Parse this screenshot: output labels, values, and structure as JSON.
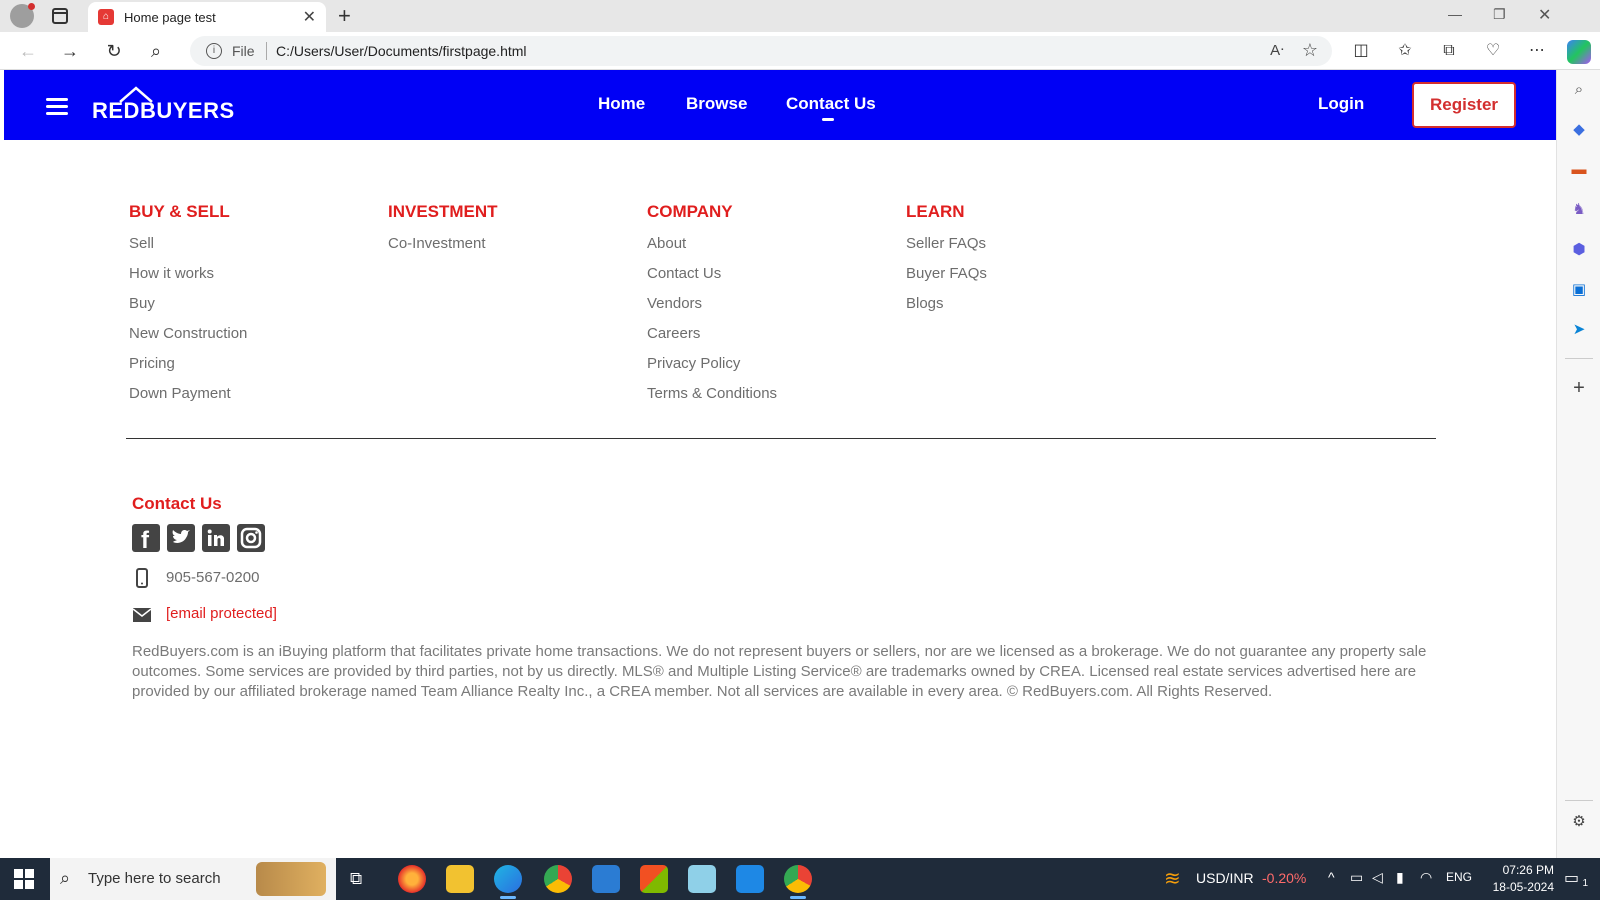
{
  "browser": {
    "tab_title": "Home page test",
    "url_scheme": "File",
    "url": "C:/Users/User/Documents/firstpage.html",
    "read_aloud": "A¹°"
  },
  "site": {
    "logo_text": "REDBUYERS",
    "nav": [
      "Home",
      "Browse",
      "Contact Us"
    ],
    "login_label": "Login",
    "register_label": "Register"
  },
  "footer": {
    "columns": [
      {
        "heading": "BUY & SELL",
        "links": [
          "Sell",
          "How it works",
          "Buy",
          "New Construction",
          "Pricing",
          "Down Payment"
        ]
      },
      {
        "heading": "INVESTMENT",
        "links": [
          "Co-Investment"
        ]
      },
      {
        "heading": "COMPANY",
        "links": [
          "About",
          "Contact Us",
          "Vendors",
          "Careers",
          "Privacy Policy",
          "Terms & Conditions"
        ]
      },
      {
        "heading": "LEARN",
        "links": [
          "Seller FAQs",
          "Buyer FAQs",
          "Blogs"
        ]
      }
    ],
    "contact_heading": "Contact Us",
    "social_icons": [
      "facebook-icon",
      "twitter-icon",
      "linkedin-icon",
      "instagram-icon"
    ],
    "phone": "905-567-0200",
    "email": "[email protected]",
    "disclaimer": "RedBuyers.com is an iBuying platform that facilitates private home transactions. We do not represent buyers or sellers, nor are we licensed as a brokerage. We do not guarantee any property sale outcomes. Some services are provided by third parties, not by us directly. MLS® and Multiple Listing Service® are trademarks owned by CREA. Licensed real estate services advertised here are provided by our affiliated brokerage named Team Alliance Realty Inc., a CREA member. Not all services are available in every area. © RedBuyers.com. All Rights Reserved."
  },
  "taskbar": {
    "search_placeholder": "Type here to search",
    "ticker": "USD/INR",
    "ticker_change": "-0.20%",
    "language": "ENG",
    "time": "07:26 PM",
    "date": "18-05-2024",
    "notification_count": "1"
  },
  "colors": {
    "header_blue": "#0000f5",
    "accent_red": "#e01e1e",
    "link_gray": "#6d6d6d"
  }
}
